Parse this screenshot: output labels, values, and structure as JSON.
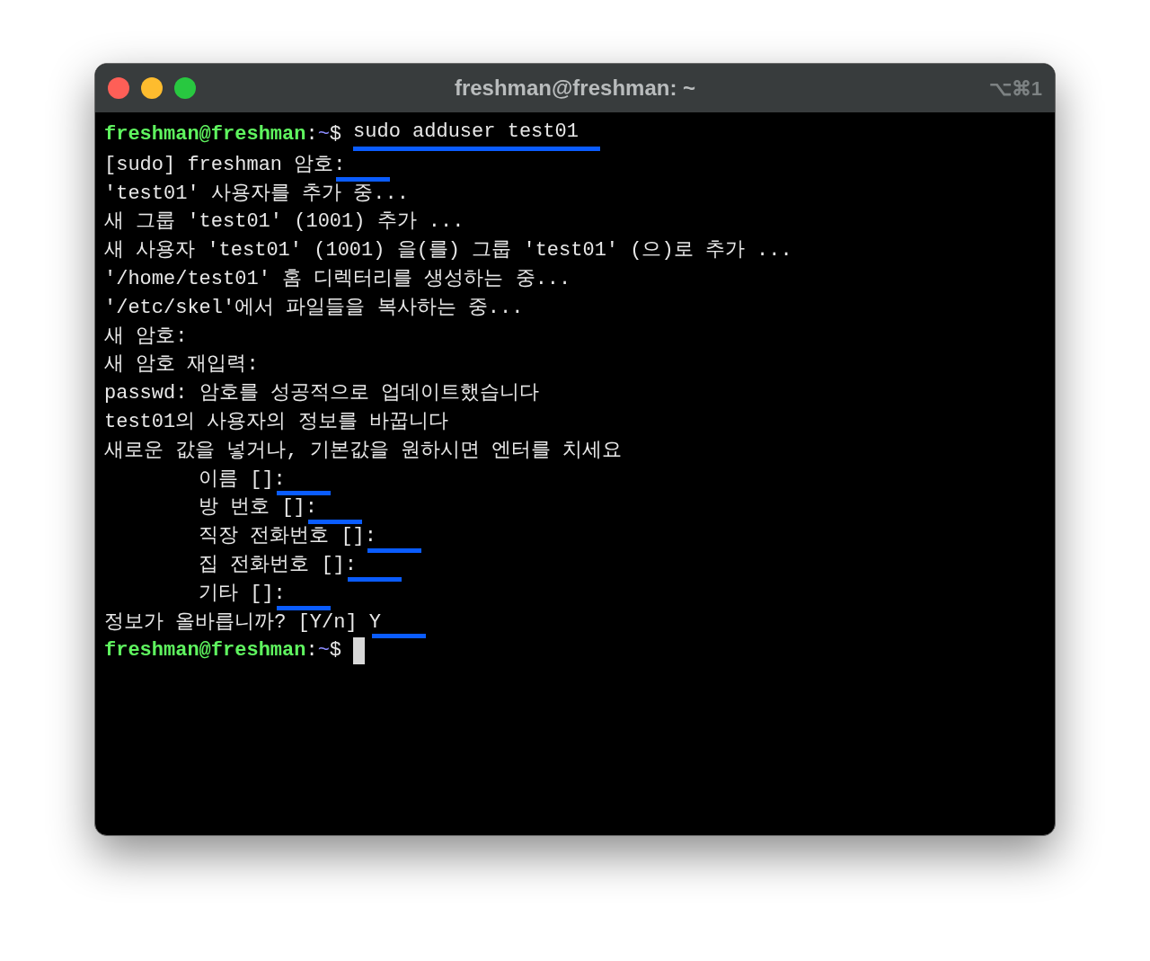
{
  "window": {
    "title": "freshman@freshman: ~",
    "shortcut": "⌥⌘1"
  },
  "lines": [
    {
      "kind": "prompt",
      "user": "freshman@freshman",
      "path": "~",
      "separator": ":",
      "symbol": "$",
      "command": "sudo adduser test01",
      "underlined": true
    },
    {
      "kind": "output",
      "text": "[sudo] freshman 암호:",
      "indented": false,
      "underlined": true
    },
    {
      "kind": "output",
      "text": "'test01' 사용자를 추가 중...",
      "indented": false,
      "underlined": false
    },
    {
      "kind": "output",
      "text": "새 그룹 'test01' (1001) 추가 ...",
      "indented": false,
      "underlined": false
    },
    {
      "kind": "output",
      "text": "새 사용자 'test01' (1001) 을(를) 그룹 'test01' (으)로 추가 ...",
      "indented": false,
      "underlined": false
    },
    {
      "kind": "output",
      "text": "'/home/test01' 홈 디렉터리를 생성하는 중...",
      "indented": false,
      "underlined": false
    },
    {
      "kind": "output",
      "text": "'/etc/skel'에서 파일들을 복사하는 중...",
      "indented": false,
      "underlined": false
    },
    {
      "kind": "output",
      "text": "새 암호:",
      "indented": false,
      "underlined": false
    },
    {
      "kind": "output",
      "text": "새 암호 재입력:",
      "indented": false,
      "underlined": false
    },
    {
      "kind": "output",
      "text": "passwd: 암호를 성공적으로 업데이트했습니다",
      "indented": false,
      "underlined": false
    },
    {
      "kind": "output",
      "text": "test01의 사용자의 정보를 바꿉니다",
      "indented": false,
      "underlined": false
    },
    {
      "kind": "output",
      "text": "새로운 값을 넣거나, 기본값을 원하시면 엔터를 치세요",
      "indented": false,
      "underlined": false
    },
    {
      "kind": "output",
      "text": "이름 []:",
      "indented": true,
      "underlined": true
    },
    {
      "kind": "output",
      "text": "방 번호 []:",
      "indented": true,
      "underlined": true
    },
    {
      "kind": "output",
      "text": "직장 전화번호 []:",
      "indented": true,
      "underlined": true
    },
    {
      "kind": "output",
      "text": "집 전화번호 []:",
      "indented": true,
      "underlined": true
    },
    {
      "kind": "output",
      "text": "기타 []:",
      "indented": true,
      "underlined": true
    },
    {
      "kind": "output",
      "text": "정보가 올바릅니까? [Y/n] Y",
      "indented": false,
      "underlined": true
    },
    {
      "kind": "prompt",
      "user": "freshman@freshman",
      "path": "~",
      "separator": ":",
      "symbol": "$",
      "cursor": true
    }
  ]
}
